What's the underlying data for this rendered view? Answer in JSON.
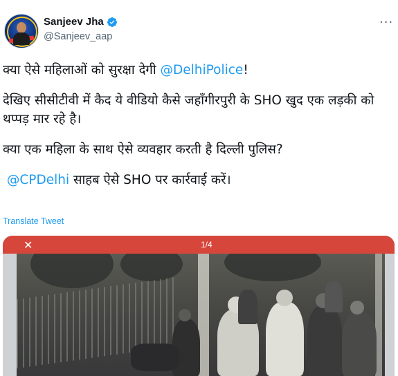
{
  "author": {
    "name": "Sanjeev Jha",
    "handle": "@Sanjeev_aap",
    "verified": true,
    "avatar_icon": "profile-photo"
  },
  "more_icon": "more-options-icon",
  "tweet": {
    "line1_prefix": "क्या ऐसे महिलाओं को सुरक्षा देगी ",
    "line1_mention": "@DelhiPolice",
    "line1_suffix": "!",
    "para2": "देखिए सीसीटीवी में कैद ये वीडियो कैसे जहाँगीरपुरी के SHO खुद एक लड़की को थप्पड़ मार रहे है।",
    "para3": "क्या एक महिला के साथ ऐसे व्यवहार करती है दिल्ली पुलिस?",
    "para4_mention": "@CPDelhi",
    "para4_suffix": " साहब ऐसे SHO पर कार्रवाई करें।"
  },
  "translate_label": "Translate Tweet",
  "media": {
    "close_glyph": "✕",
    "pager": "1/4"
  },
  "colors": {
    "link": "#1d9bf0",
    "text": "#0f1419",
    "secondary": "#536471",
    "media_topbar": "#d7463b"
  }
}
